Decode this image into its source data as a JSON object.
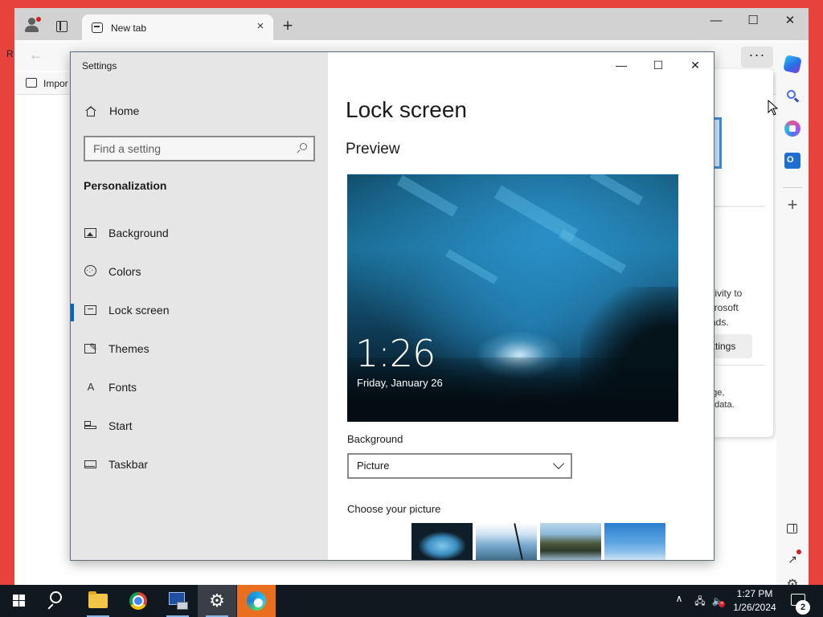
{
  "desktop": {
    "edge_text": "R"
  },
  "browser": {
    "tab": {
      "title": "New tab",
      "close_glyph": "×"
    },
    "new_tab_glyph": "+",
    "window_controls": {
      "minimize": "—",
      "maximize": "☐",
      "close": "✕"
    },
    "toolbar": {
      "back_glyph": "←",
      "more_glyph": "···"
    },
    "bookmarks_bar": {
      "label": "Impor"
    },
    "sidebar_icons": [
      "copilot-icon",
      "search-icon",
      "microsoft-365-icon",
      "outlook-icon",
      "add-icon",
      "split-screen-icon",
      "external-link-icon",
      "settings-icon"
    ],
    "side_panel": {
      "text_lines": [
        "ctivity to",
        "icrosoft",
        "ads."
      ],
      "button_label": "ettings",
      "small_lines": [
        "age,",
        "g data."
      ]
    }
  },
  "settings": {
    "app_title": "Settings",
    "caption_buttons": {
      "minimize": "—",
      "maximize": "☐",
      "close": "✕"
    },
    "nav": {
      "home_label": "Home",
      "search_placeholder": "Find a setting",
      "section_heading": "Personalization",
      "items": [
        {
          "label": "Background",
          "icon": "picture-icon",
          "selected": false
        },
        {
          "label": "Colors",
          "icon": "palette-icon",
          "selected": false
        },
        {
          "label": "Lock screen",
          "icon": "lock-screen-icon",
          "selected": true
        },
        {
          "label": "Themes",
          "icon": "themes-icon",
          "selected": false
        },
        {
          "label": "Fonts",
          "icon": "fonts-icon",
          "selected": false
        },
        {
          "label": "Start",
          "icon": "start-icon",
          "selected": false
        },
        {
          "label": "Taskbar",
          "icon": "taskbar-icon",
          "selected": false
        }
      ]
    },
    "content": {
      "page_title": "Lock screen",
      "preview_heading": "Preview",
      "preview": {
        "time": "1:26",
        "date": "Friday, January 26"
      },
      "background_label": "Background",
      "background_value": "Picture",
      "choose_label": "Choose your picture",
      "thumbnails": [
        "ice-cave-thumbnail",
        "sky-thumbnail",
        "mountain-lake-thumbnail",
        "blue-sky-thumbnail"
      ]
    },
    "accent_color": "#0067c0"
  },
  "taskbar": {
    "apps": [
      "start-icon",
      "search-icon",
      "file-explorer-icon",
      "chrome-icon",
      "network-app-icon",
      "settings-icon",
      "edge-icon"
    ],
    "tray": {
      "chevron": "∧",
      "time": "1:27 PM",
      "date": "1/26/2024",
      "notification_count": "2"
    }
  }
}
